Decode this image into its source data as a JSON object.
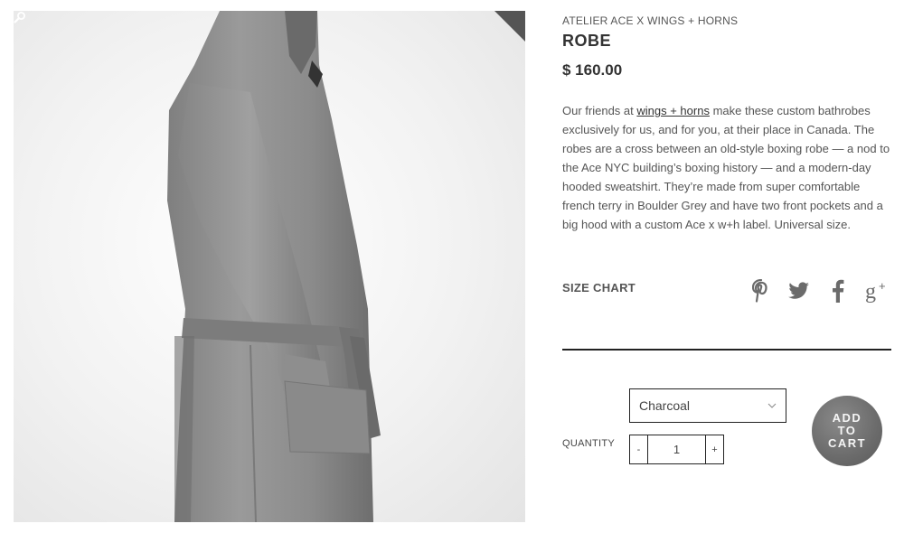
{
  "product": {
    "brand": "ATELIER ACE X WINGS + HORNS",
    "title": "ROBE",
    "price": "$ 160.00",
    "image_alt": "Grey hooded bathrobe",
    "description": {
      "before_link": "Our friends at ",
      "link_text": "wings + horns",
      "after_link": " make these custom bathrobes exclusively for us, and for you, at their place in Canada. The robes are a cross between an old-style boxing robe — a nod to the Ace NYC building’s boxing history — and a modern-day hooded sweatshirt. They’re made from super comfortable french terry in Boulder Grey and have two front pockets and a big hood with a custom Ace x w+h label. Universal size."
    }
  },
  "size_chart_label": "SIZE CHART",
  "social": [
    {
      "icon": "pinterest-icon",
      "glyph": "P"
    },
    {
      "icon": "twitter-icon",
      "glyph": "bird"
    },
    {
      "icon": "facebook-icon",
      "glyph": "f"
    },
    {
      "icon": "google-plus-icon",
      "glyph": "g+"
    }
  ],
  "variant": {
    "selected": "Charcoal"
  },
  "quantity": {
    "label": "QUANTITY",
    "value": "1",
    "minus": "-",
    "plus": "+"
  },
  "add_to_cart": {
    "line1": "ADD",
    "line2": "TO",
    "line3": "CART"
  },
  "icons": {
    "zoom": "magnifier-icon",
    "caret": "chevron-down-icon"
  },
  "colors": {
    "accent_grey": "#6b6b6b",
    "text": "#333333",
    "rule": "#222222"
  }
}
